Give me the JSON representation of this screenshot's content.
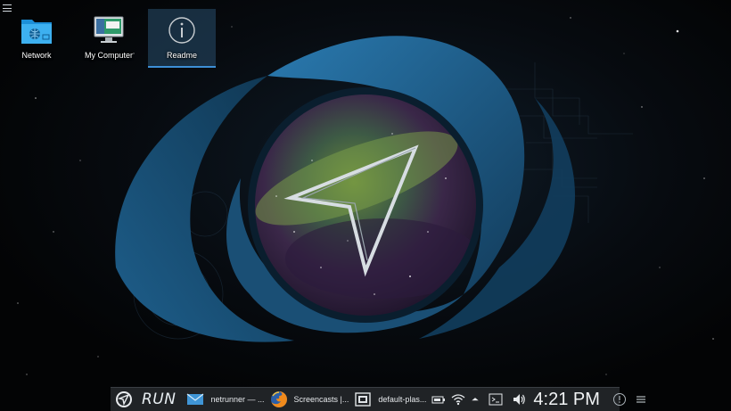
{
  "desktop": {
    "menu_icon": "hamburger-icon",
    "icons": [
      {
        "label": "Network",
        "icon": "network-folder-icon"
      },
      {
        "label": "My Computer",
        "icon": "computer-icon"
      },
      {
        "label": "Readme",
        "icon": "info-icon",
        "selected": true
      }
    ]
  },
  "taskbar": {
    "launcher_icon": "netrunner-logo-icon",
    "run_label": "RUN",
    "tasks": [
      {
        "label": "netrunner — ...",
        "icon": "mail-icon"
      },
      {
        "label": "Screencasts |...",
        "icon": "firefox-icon"
      },
      {
        "label": "default-plas...",
        "icon": "screen-window-icon"
      }
    ],
    "tray": {
      "icons": [
        "battery-icon",
        "wifi-icon",
        "expand-arrow-icon",
        "terminal-icon",
        "volume-icon"
      ],
      "clock": "4:21 PM",
      "notification_icon": "notifications-icon",
      "panel_menu_icon": "panel-menu-icon"
    }
  },
  "colors": {
    "accent": "#3d8fd6",
    "panel": "#202326",
    "swirl": "#1f5f8a"
  }
}
